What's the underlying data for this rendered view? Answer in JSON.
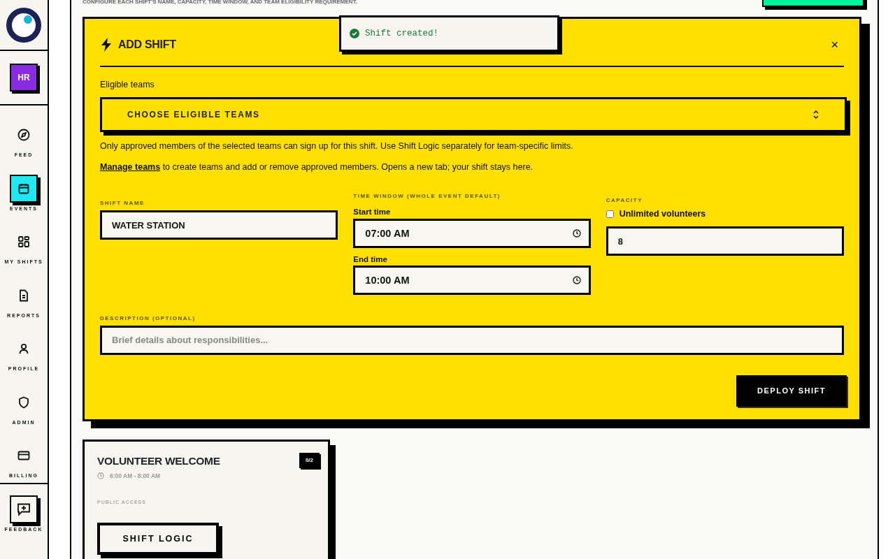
{
  "sidebar": {
    "avatar": "HR",
    "nav": [
      {
        "label": "FEED",
        "selected": false
      },
      {
        "label": "EVENTS",
        "selected": true
      },
      {
        "label": "MY SHIFTS",
        "selected": false
      },
      {
        "label": "REPORTS",
        "selected": false
      },
      {
        "label": "PROFILE",
        "selected": false
      },
      {
        "label": "ADMIN",
        "selected": false
      },
      {
        "label": "BILLING",
        "selected": false
      }
    ],
    "feedback": "FEEDBACK"
  },
  "page": {
    "subtitle": "CONFIGURE EACH SHIFT'S NAME, CAPACITY, TIME WINDOW, AND TEAM ELIGIBILITY REQUIREMENT."
  },
  "toast": {
    "message": "Shift created!"
  },
  "modal": {
    "title": "ADD SHIFT",
    "close": "×",
    "eligible_label": "Eligible teams",
    "eligible_select": "CHOOSE ELIGIBLE TEAMS",
    "help": "Only approved members of the selected teams can sign up for this shift. Use Shift Logic separately for team-specific limits.",
    "manage_link": "Manage teams",
    "manage_text": " to create teams and add or remove approved members. Opens a new tab; your shift stays here.",
    "shift_name_label": "SHIFT NAME",
    "shift_name": "WATER STATION",
    "time_label": "TIME WINDOW (WHOLE EVENT DEFAULT)",
    "start_label": "Start time",
    "start": "07:00 AM",
    "end_label": "End time",
    "end": "10:00 AM",
    "capacity_label": "CAPACITY",
    "unlimited_label": "Unlimited volunteers",
    "unlimited_checked": false,
    "capacity": "8",
    "description_label": "DESCRIPTION (OPTIONAL)",
    "description_placeholder": "Brief details about responsibilities...",
    "submit": "DEPLOY SHIFT"
  },
  "shift_cards": [
    {
      "title": "VOLUNTEER WELCOME",
      "count": "0/2",
      "time": "6:00 AM - 8:00 AM",
      "access": "PUBLIC ACCESS",
      "button": "SHIFT LOGIC"
    }
  ]
}
